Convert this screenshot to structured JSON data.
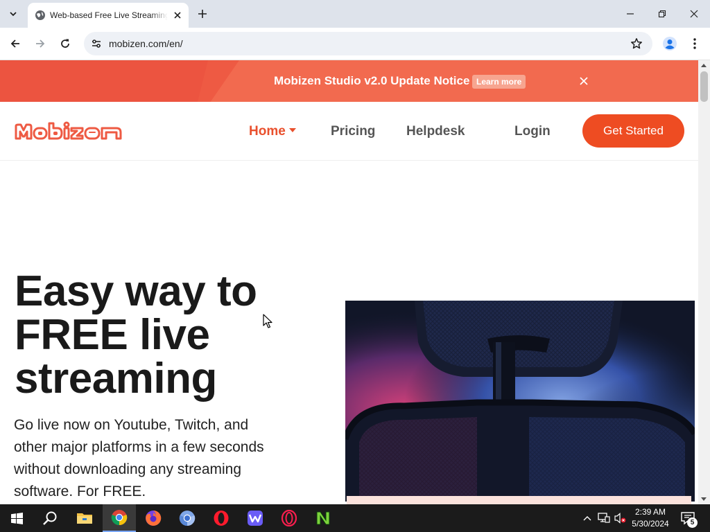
{
  "browser": {
    "tab": {
      "title": "Web-based Free Live Streaming"
    },
    "url": "mobizen.com/en/"
  },
  "banner": {
    "text": "Mobizen Studio v2.0 Update Notice",
    "learn_more": "Learn more"
  },
  "nav": {
    "logo_text": "Mobizen",
    "items": [
      {
        "label": "Home"
      },
      {
        "label": "Pricing"
      },
      {
        "label": "Helpdesk"
      },
      {
        "label": "Login"
      }
    ],
    "cta": "Get Started"
  },
  "hero": {
    "title_lines": [
      "Easy way to",
      "FREE live",
      "streaming"
    ],
    "subtitle_lines": [
      "Go live now on Youtube, Twitch, and",
      "other major platforms in a few seconds",
      "without downloading any streaming",
      "software. For FREE."
    ]
  },
  "taskbar": {
    "apps": [
      "start-icon",
      "search-icon",
      "file-explorer-icon",
      "chrome-icon",
      "firefox-icon",
      "chromium-icon",
      "opera-icon",
      "mailbird-icon",
      "opera-gx-icon",
      "notepad-plus-plus-icon"
    ],
    "time": "2:39 AM",
    "date": "5/30/2024",
    "notifications": "5"
  },
  "colors": {
    "brand": "#ee4c22",
    "banner": "#f26a4f",
    "tabstrip": "#dee3eb"
  }
}
